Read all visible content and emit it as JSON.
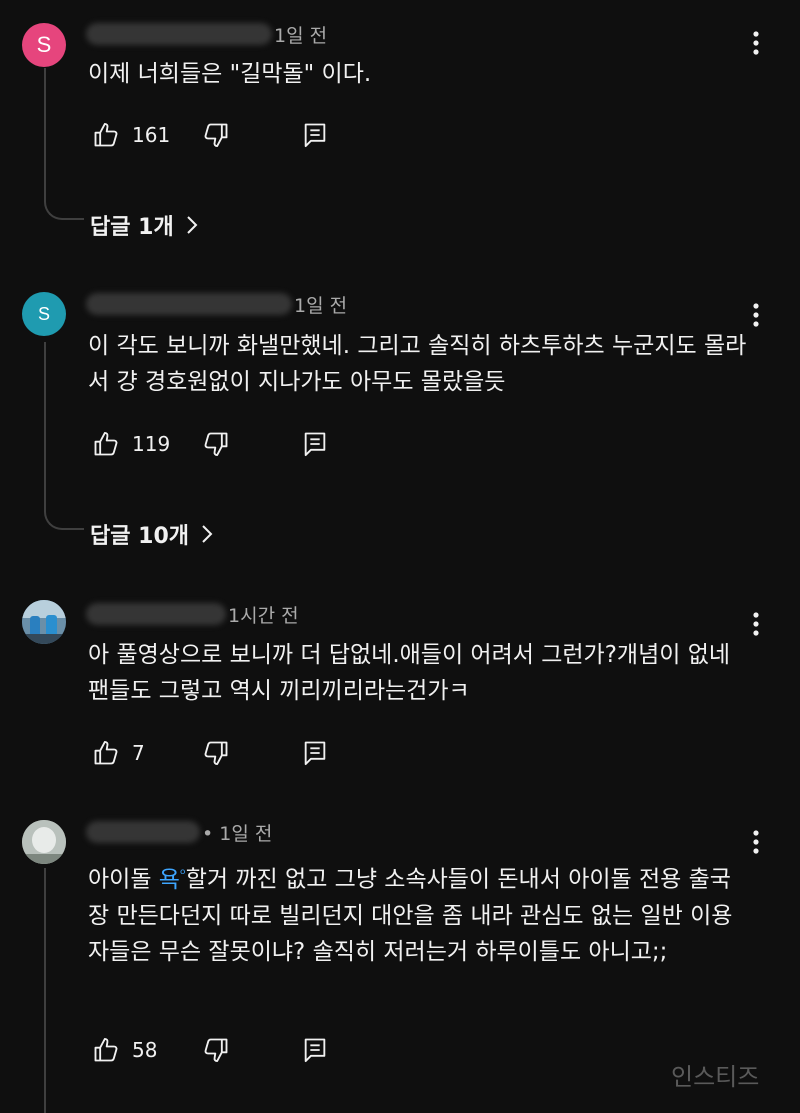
{
  "icons": {
    "like": "thumbs-up-outline-icon",
    "dislike": "thumbs-down-outline-icon",
    "reply": "comment-reply-icon",
    "more": "vertical-dots-icon",
    "chevron": "chevron-right-icon"
  },
  "colors": {
    "background": "#0f0f0f",
    "text": "#f1f1f1",
    "secondary_text": "#aaaaaa",
    "mention": "#3ea6ff",
    "avatar_1": "#e6457d",
    "avatar_2": "#1f9bb0"
  },
  "comments": [
    {
      "avatar_letter": "S",
      "time": "1일 전",
      "text": "이제 너희들은 \"길막돌\" 이다.",
      "likes": "161",
      "replies_label": "답글 1개"
    },
    {
      "avatar_letter": "S",
      "time": "1일 전",
      "text": "이 각도 보니까 화낼만했네. 그리고 솔직히 하츠투하츠 누군지도 몰라서 걍 경호원없이 지나가도 아무도 몰랐을듯",
      "likes": "119",
      "replies_label": "답글 10개"
    },
    {
      "time": "1시간 전",
      "text": "아 풀영상으로 보니까 더 답없네.애들이 어려서 그런가?개념이 없네 팬들도 그렇고 역시 끼리끼리라는건가ㅋ",
      "likes": "7"
    },
    {
      "time": "• 1일 전",
      "text_before": "아이돌 ",
      "mention": "욕",
      "text_after": "할거 까진 없고 그냥 소속사들이 돈내서 아이돌 전용 출국장 만든다던지 따로 빌리던지 대안을 좀 내라 관심도 없는 일반 이용자들은 무슨 잘못이냐? 솔직히 저러는거 하루이틀도 아니고;;",
      "likes": "58"
    }
  ],
  "watermark": "인스티즈"
}
